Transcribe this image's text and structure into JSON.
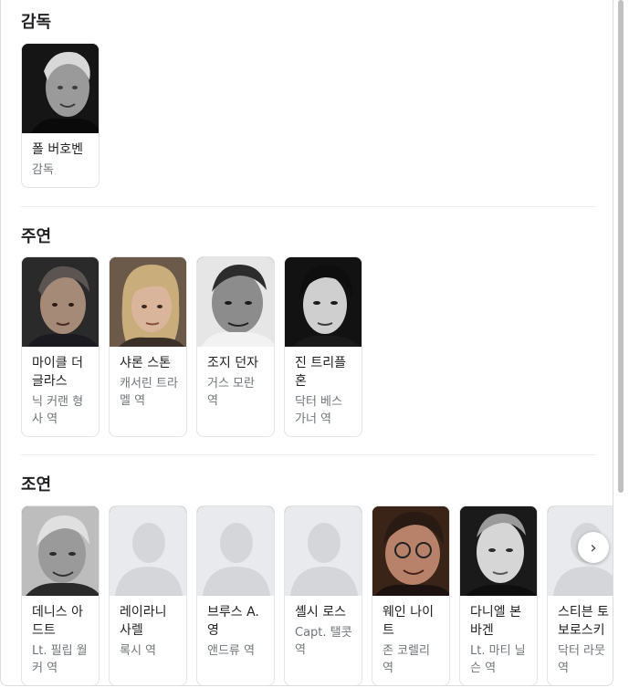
{
  "sections": {
    "director": {
      "title": "감독",
      "people": [
        {
          "name": "폴 버호벤",
          "role": "감독"
        }
      ]
    },
    "starring": {
      "title": "주연",
      "people": [
        {
          "name": "마이클 더글라스",
          "role": "닉 커랜 형사 역"
        },
        {
          "name": "샤론 스톤",
          "role": "캐서린 트라멜 역"
        },
        {
          "name": "조지 던자",
          "role": "거스 모란 역"
        },
        {
          "name": "진 트리플혼",
          "role": "닥터 베스 가너 역"
        }
      ]
    },
    "supporting": {
      "title": "조연",
      "people": [
        {
          "name": "데니스 아드트",
          "role": "Lt. 필립 월커 역"
        },
        {
          "name": "레이라니 사렐",
          "role": "록시 역"
        },
        {
          "name": "브루스 A. 영",
          "role": "앤드류 역"
        },
        {
          "name": "셸시 로스",
          "role": "Capt. 탤콧 역"
        },
        {
          "name": "웨인 나이트",
          "role": "존 코렐리 역"
        },
        {
          "name": "다니엘 본바겐",
          "role": "Lt. 마티 닐슨 역"
        },
        {
          "name": "스티븐 토보로스키",
          "role": "닥터 라뭇 역"
        }
      ]
    }
  },
  "controls": {
    "next_icon": "chevron-right-icon",
    "next_glyph": "›"
  },
  "colors": {
    "text_primary": "#202124",
    "text_secondary": "#70757a",
    "border": "#e3e3e3",
    "placeholder_bg": "#e8eaed",
    "placeholder_silhouette": "#d4d6da"
  }
}
